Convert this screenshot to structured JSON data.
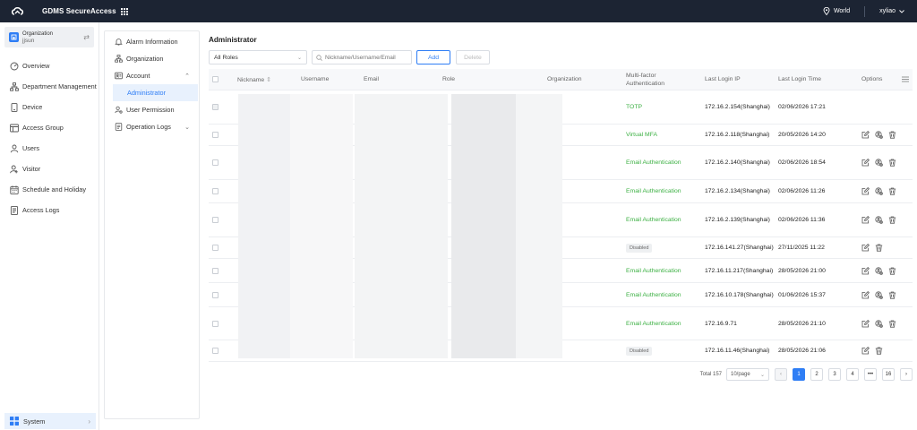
{
  "app": {
    "title": "GDMS SecureAccess"
  },
  "topbar": {
    "region": "World",
    "username": "xyliao"
  },
  "sidebar": {
    "org_label": "Organization",
    "org_user": "jjsun",
    "items": [
      {
        "label": "Overview",
        "icon": "overview-icon"
      },
      {
        "label": "Department Management",
        "icon": "department-icon"
      },
      {
        "label": "Device",
        "icon": "device-icon"
      },
      {
        "label": "Access Group",
        "icon": "access-group-icon"
      },
      {
        "label": "Users",
        "icon": "users-icon"
      },
      {
        "label": "Visitor",
        "icon": "visitor-icon"
      },
      {
        "label": "Schedule and Holiday",
        "icon": "calendar-icon"
      },
      {
        "label": "Access Logs",
        "icon": "access-logs-icon"
      }
    ],
    "system_label": "System"
  },
  "subnav": {
    "alarm": "Alarm Information",
    "organization": "Organization",
    "account": "Account",
    "administrator": "Administrator",
    "user_permission": "User Permission",
    "operation_logs": "Operation Logs"
  },
  "page": {
    "title": "Administrator",
    "role_filter": "All Roles",
    "search_placeholder": "Nickname/Username/Email",
    "add_label": "Add",
    "delete_label": "Delete"
  },
  "table": {
    "headers": {
      "nickname": "Nickname",
      "username": "Username",
      "email": "Email",
      "role": "Role",
      "organization": "Organization",
      "mfa_line1": "Multi-factor",
      "mfa_line2": "Authentication",
      "last_ip": "Last Login IP",
      "last_time": "Last Login Time",
      "options": "Options"
    },
    "rows": [
      {
        "mfa": "TOTP",
        "mfa_type": "green",
        "ip": "172.16.2.154(Shanghai)",
        "time": "02/06/2026 17:21",
        "h": 38,
        "delete": false,
        "perm": false,
        "edit": false,
        "check_disabled": true
      },
      {
        "mfa": "Virtual MFA",
        "mfa_type": "green",
        "ip": "172.16.2.118(Shanghai)",
        "time": "20/05/2026 14:20",
        "h": 24,
        "delete": true,
        "perm": true,
        "edit": true,
        "check_disabled": false
      },
      {
        "mfa": "Email Authentication",
        "mfa_type": "green",
        "ip": "172.16.2.140(Shanghai)",
        "time": "02/06/2026 18:54",
        "h": 38,
        "delete": true,
        "perm": true,
        "edit": true,
        "check_disabled": false
      },
      {
        "mfa": "Email Authentication",
        "mfa_type": "green",
        "ip": "172.16.2.134(Shanghai)",
        "time": "02/06/2026 11:26",
        "h": 26,
        "delete": true,
        "perm": true,
        "edit": true,
        "check_disabled": false
      },
      {
        "mfa": "Email Authentication",
        "mfa_type": "green",
        "ip": "172.16.2.139(Shanghai)",
        "time": "02/06/2026 11:36",
        "h": 38,
        "delete": true,
        "perm": true,
        "edit": true,
        "check_disabled": false
      },
      {
        "mfa": "Disabled",
        "mfa_type": "badge",
        "ip": "172.16.141.27(Shanghai)",
        "time": "27/11/2025 11:22",
        "h": 24,
        "delete": true,
        "perm": false,
        "edit": true,
        "check_disabled": false
      },
      {
        "mfa": "Email Authentication",
        "mfa_type": "green",
        "ip": "172.16.11.217(Shanghai)",
        "time": "28/05/2026 21:00",
        "h": 27,
        "delete": true,
        "perm": true,
        "edit": true,
        "check_disabled": false
      },
      {
        "mfa": "Email Authentication",
        "mfa_type": "green",
        "ip": "172.16.10.178(Shanghai)",
        "time": "01/06/2026 15:37",
        "h": 27,
        "delete": true,
        "perm": true,
        "edit": true,
        "check_disabled": false
      },
      {
        "mfa": "Email Authentication",
        "mfa_type": "green",
        "ip": "172.16.9.71",
        "time": "28/05/2026 21:10",
        "h": 37,
        "delete": true,
        "perm": true,
        "edit": true,
        "check_disabled": false
      },
      {
        "mfa": "Disabled",
        "mfa_type": "badge",
        "ip": "172.16.11.46(Shanghai)",
        "time": "28/05/2026 21:06",
        "h": 24,
        "delete": true,
        "perm": false,
        "edit": true,
        "check_disabled": false
      }
    ]
  },
  "pager": {
    "total": "Total 157",
    "page_size": "10/page",
    "pages": [
      "1",
      "2",
      "3",
      "4",
      "•••",
      "16"
    ],
    "active": "1"
  },
  "colors": {
    "accent": "#2f7ef5",
    "topbar": "#1c2433",
    "mfa_green": "#3cb043"
  }
}
